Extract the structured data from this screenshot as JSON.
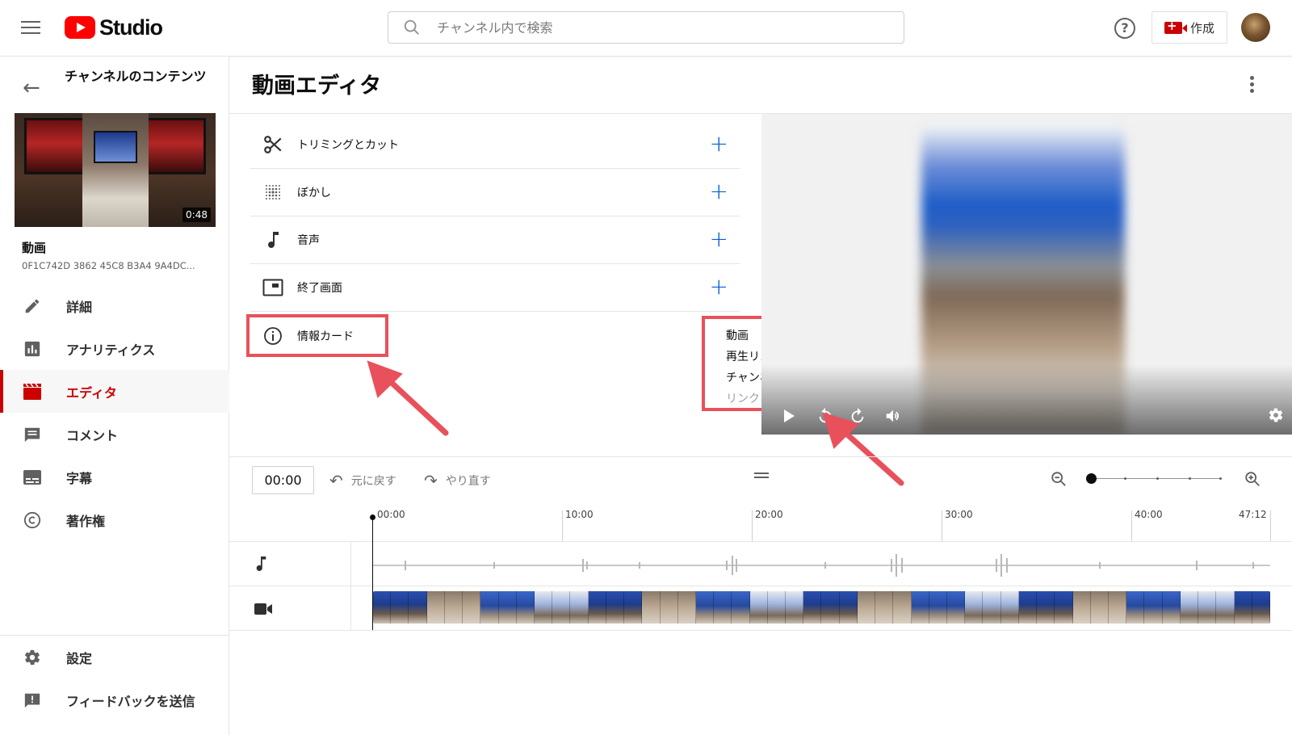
{
  "header": {
    "logo_text": "Studio",
    "search_placeholder": "チャンネル内で検索",
    "help_label": "?",
    "create_label": "作成"
  },
  "sidebar": {
    "title": "チャンネルのコンテンツ",
    "thumbnail_duration": "0:48",
    "video_label": "動画",
    "video_id": "0F1C742D 3862 45C8 B3A4 9A4DC...",
    "nav": [
      {
        "label": "詳細",
        "icon": "pencil-icon"
      },
      {
        "label": "アナリティクス",
        "icon": "analytics-icon"
      },
      {
        "label": "エディタ",
        "icon": "clapperboard-icon",
        "active": true
      },
      {
        "label": "コメント",
        "icon": "comment-icon"
      },
      {
        "label": "字幕",
        "icon": "subtitles-icon"
      },
      {
        "label": "著作権",
        "icon": "copyright-icon"
      }
    ],
    "nav_bottom": [
      {
        "label": "設定",
        "icon": "gear-icon"
      },
      {
        "label": "フィードバックを送信",
        "icon": "feedback-icon"
      }
    ]
  },
  "main": {
    "title": "動画エディタ",
    "tools": [
      {
        "label": "トリミングとカット",
        "icon": "scissors-icon"
      },
      {
        "label": "ぼかし",
        "icon": "blur-icon"
      },
      {
        "label": "音声",
        "icon": "music-note-icon"
      },
      {
        "label": "終了画面",
        "icon": "end-screen-icon"
      },
      {
        "label": "情報カード",
        "icon": "info-icon"
      }
    ],
    "card_menu": [
      "動画",
      "再生リスト",
      "チャンネル",
      "リンク"
    ],
    "plus_label": "+"
  },
  "timeline": {
    "time_value": "00:00",
    "undo_label": "元に戻す",
    "redo_label": "やり直す",
    "ticks": [
      "00:00",
      "10:00",
      "20:00",
      "30:00",
      "40:00",
      "47:12"
    ]
  },
  "colors": {
    "accent_red": "#cc0000",
    "annotation_red": "#e8515b",
    "link_blue": "#065fd4"
  }
}
